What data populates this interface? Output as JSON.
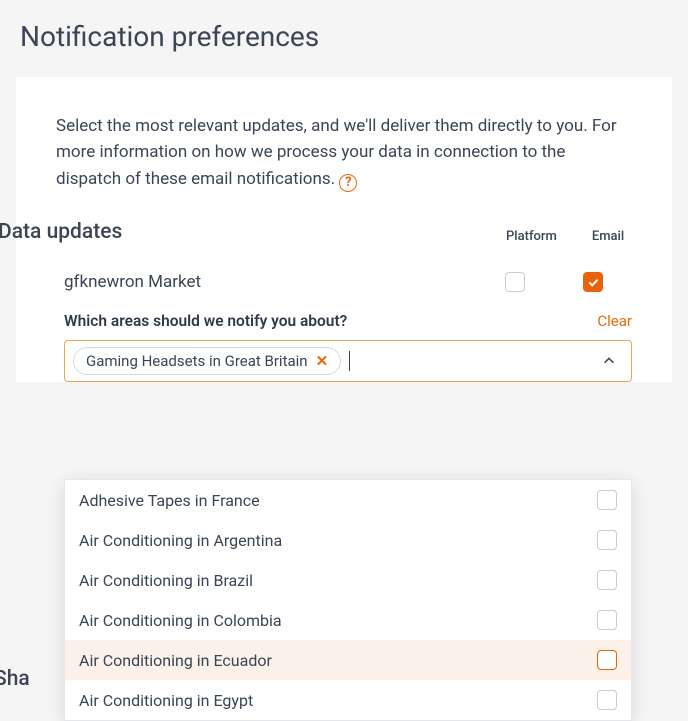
{
  "page": {
    "title": "Notification preferences"
  },
  "intro": {
    "text": "Select the most relevant updates, and we'll deliver them directly to you. For more information on how we process your data in connection to the dispatch of these email notifications.",
    "help_glyph": "?"
  },
  "section": {
    "title": "Data updates",
    "col_platform": "Platform",
    "col_email": "Email"
  },
  "rows": [
    {
      "label": "gfknewron Market",
      "platform_checked": false,
      "email_checked": true
    }
  ],
  "areas": {
    "prompt": "Which areas should we notify you about?",
    "clear": "Clear",
    "chip": "Gaming Headsets in Great Britain",
    "chip_x": "✕",
    "input_value": ""
  },
  "options": [
    {
      "label": "Adhesive Tapes in France",
      "hover": false
    },
    {
      "label": "Air Conditioning in Argentina",
      "hover": false
    },
    {
      "label": "Air Conditioning in Brazil",
      "hover": false
    },
    {
      "label": "Air Conditioning in Colombia",
      "hover": false
    },
    {
      "label": "Air Conditioning in Ecuador",
      "hover": true
    },
    {
      "label": "Air Conditioning in Egypt",
      "hover": false
    }
  ],
  "partial_section": "Sha"
}
